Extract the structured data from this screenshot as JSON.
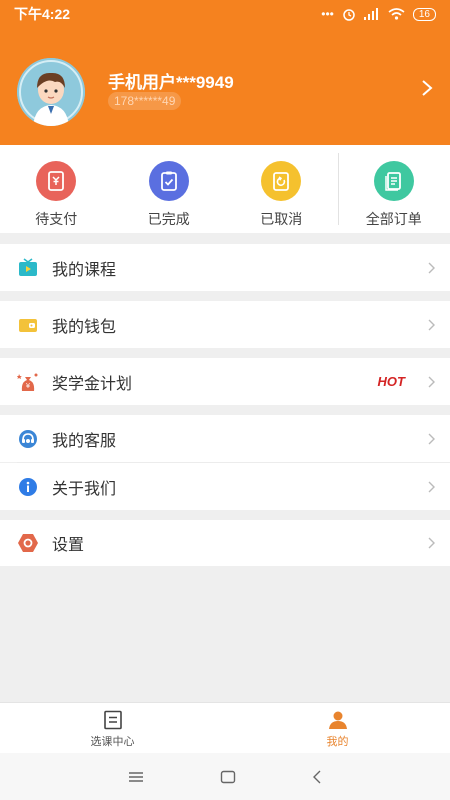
{
  "status_bar": {
    "time": "下午4:22",
    "dots": "•••",
    "battery": "16"
  },
  "profile": {
    "name": "手机用户***9949",
    "phone": "178******49"
  },
  "orders": [
    {
      "label": "待支付",
      "color": "#e8635a"
    },
    {
      "label": "已完成",
      "color": "#5a6fe0"
    },
    {
      "label": "已取消",
      "color": "#f5c12e"
    },
    {
      "label": "全部订单",
      "color": "#3fc8a0"
    }
  ],
  "menu": {
    "courses": "我的课程",
    "wallet": "我的钱包",
    "scholarship": "奖学金计划",
    "scholarship_badge": "HOT",
    "service": "我的客服",
    "about": "关于我们",
    "settings": "设置"
  },
  "tabs": [
    {
      "label": "选课中心",
      "active": false
    },
    {
      "label": "我的",
      "active": true
    }
  ],
  "colors": {
    "brand": "#f5821f",
    "accent": "#e8842e",
    "hot": "#d42424"
  }
}
